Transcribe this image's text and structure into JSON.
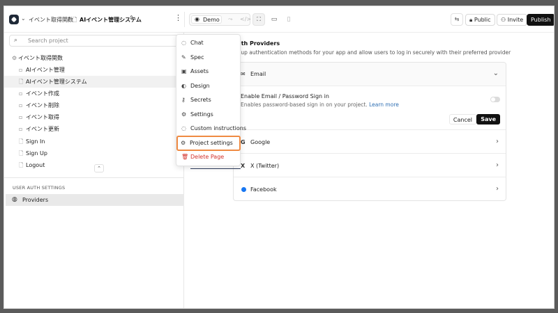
{
  "topbar": {
    "breadcrumb_parent": "イベント取得関数",
    "breadcrumb_separator": "/",
    "breadcrumb_current": "AIイベント管理システム",
    "demo_label": "Demo",
    "public_label": "Public",
    "invite_label": "Invite",
    "publish_label": "Publish"
  },
  "sidebar": {
    "search_placeholder": "Search project",
    "tree": [
      {
        "label": "イベント取得関数",
        "icon": "gear-icon"
      },
      {
        "label": "AIイベント管理",
        "icon": "page-icon"
      },
      {
        "label": "AIイベント管理システム",
        "icon": "page-icon",
        "selected": true
      },
      {
        "label": "イベント作成",
        "icon": "page-icon"
      },
      {
        "label": "イベント削除",
        "icon": "page-icon"
      },
      {
        "label": "イベント取得",
        "icon": "page-icon"
      },
      {
        "label": "イベント更新",
        "icon": "page-icon"
      },
      {
        "label": "Sign In",
        "icon": "page-icon"
      },
      {
        "label": "Sign Up",
        "icon": "page-icon"
      },
      {
        "label": "Logout",
        "icon": "page-icon"
      }
    ],
    "section_title": "USER AUTH SETTINGS",
    "providers_label": "Providers"
  },
  "menu": {
    "items": [
      {
        "label": "Chat",
        "icon": "chat-icon"
      },
      {
        "label": "Spec",
        "icon": "edit-icon"
      },
      {
        "label": "Assets",
        "icon": "image-icon"
      },
      {
        "label": "Design",
        "icon": "palette-icon"
      },
      {
        "label": "Secrets",
        "icon": "key-icon"
      },
      {
        "label": "Settings",
        "icon": "gear-icon"
      },
      {
        "label": "Custom instructions",
        "icon": "message-icon"
      },
      {
        "label": "Project settings",
        "icon": "gear-icon",
        "highlighted": true
      },
      {
        "label": "Delete Page",
        "icon": "trash-icon",
        "danger": true
      }
    ]
  },
  "main": {
    "title": "uth Providers",
    "description": "t up authentication methods for your app and allow users to log in securely with their preferred provider",
    "email": {
      "label": "Email",
      "option_title": "Enable Email / Password Sign in",
      "option_desc": "Enables password-based sign in on your project.",
      "learn_more": "Learn more",
      "toggle_on": false,
      "cancel_label": "Cancel",
      "save_label": "Save"
    },
    "providers": [
      {
        "label": "Google",
        "icon": "google-icon"
      },
      {
        "label": "X (Twitter)",
        "icon": "x-icon"
      },
      {
        "label": "Facebook",
        "icon": "facebook-icon"
      }
    ]
  },
  "colors": {
    "highlight": "#ef8a42",
    "danger": "#d3312a",
    "link": "#2f6fb3",
    "dark_button": "#111111"
  }
}
